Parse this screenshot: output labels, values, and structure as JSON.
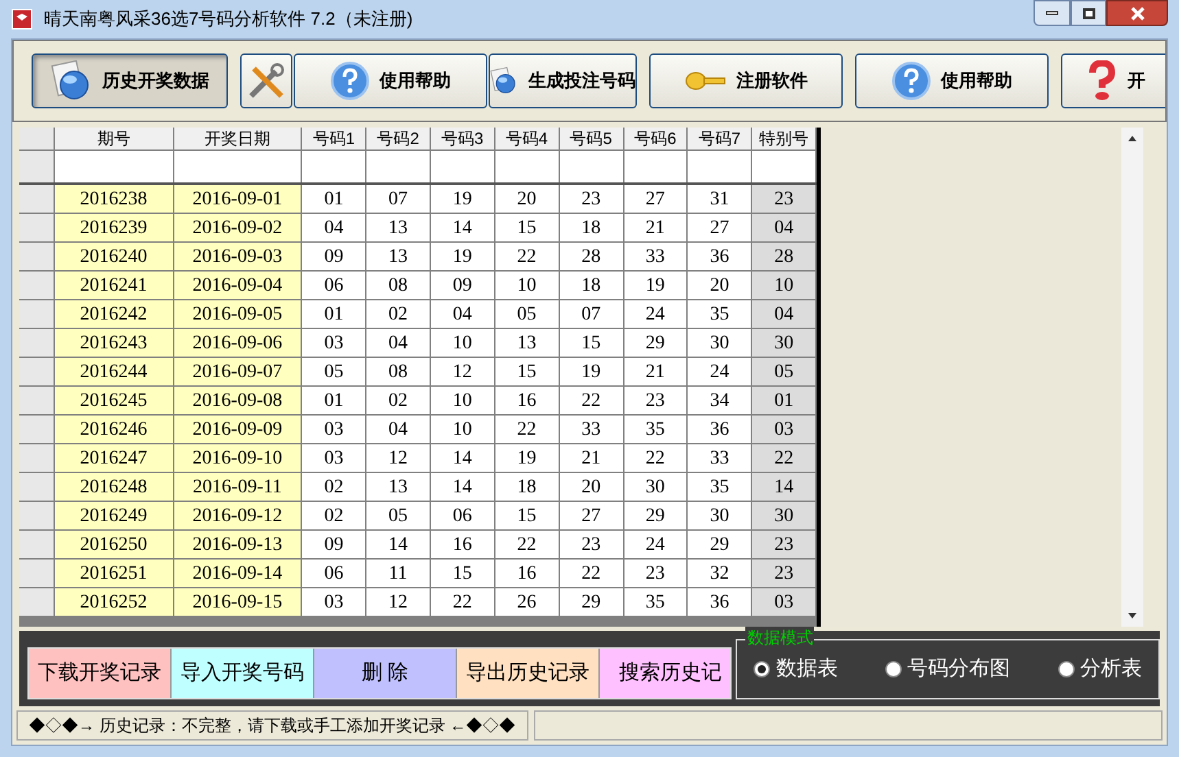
{
  "window": {
    "title": "晴天南粤风采36选7号码分析软件 7.2（未注册)"
  },
  "toolbar": {
    "buttons": [
      {
        "label": "历史开奖数据",
        "kind": "globe",
        "selected": true
      },
      {
        "kind": "tools",
        "selected": false
      },
      {
        "label": "使用帮助",
        "kind": "help",
        "selected": false
      },
      {
        "label": "生成投注号码",
        "kind": "globe",
        "selected": false
      },
      {
        "label": "注册软件",
        "kind": "key",
        "selected": false
      },
      {
        "label": "使用帮助",
        "kind": "help",
        "selected": false
      },
      {
        "label": "开",
        "kind": "question-red",
        "selected": false
      }
    ]
  },
  "table": {
    "columns": [
      "期号",
      "开奖日期",
      "号码1",
      "号码2",
      "号码3",
      "号码4",
      "号码5",
      "号码6",
      "号码7",
      "特别号"
    ],
    "rows": [
      [
        "2016238",
        "2016-09-01",
        "01",
        "07",
        "19",
        "20",
        "23",
        "27",
        "31",
        "23"
      ],
      [
        "2016239",
        "2016-09-02",
        "04",
        "13",
        "14",
        "15",
        "18",
        "21",
        "27",
        "04"
      ],
      [
        "2016240",
        "2016-09-03",
        "09",
        "13",
        "19",
        "22",
        "28",
        "33",
        "36",
        "28"
      ],
      [
        "2016241",
        "2016-09-04",
        "06",
        "08",
        "09",
        "10",
        "18",
        "19",
        "20",
        "10"
      ],
      [
        "2016242",
        "2016-09-05",
        "01",
        "02",
        "04",
        "05",
        "07",
        "24",
        "35",
        "04"
      ],
      [
        "2016243",
        "2016-09-06",
        "03",
        "04",
        "10",
        "13",
        "15",
        "29",
        "30",
        "30"
      ],
      [
        "2016244",
        "2016-09-07",
        "05",
        "08",
        "12",
        "15",
        "19",
        "21",
        "24",
        "05"
      ],
      [
        "2016245",
        "2016-09-08",
        "01",
        "02",
        "10",
        "16",
        "22",
        "23",
        "34",
        "01"
      ],
      [
        "2016246",
        "2016-09-09",
        "03",
        "04",
        "10",
        "22",
        "33",
        "35",
        "36",
        "03"
      ],
      [
        "2016247",
        "2016-09-10",
        "03",
        "12",
        "14",
        "19",
        "21",
        "22",
        "33",
        "22"
      ],
      [
        "2016248",
        "2016-09-11",
        "02",
        "13",
        "14",
        "18",
        "20",
        "30",
        "35",
        "14"
      ],
      [
        "2016249",
        "2016-09-12",
        "02",
        "05",
        "06",
        "15",
        "27",
        "29",
        "30",
        "30"
      ],
      [
        "2016250",
        "2016-09-13",
        "09",
        "14",
        "16",
        "22",
        "23",
        "24",
        "29",
        "23"
      ],
      [
        "2016251",
        "2016-09-14",
        "06",
        "11",
        "15",
        "16",
        "22",
        "23",
        "32",
        "23"
      ],
      [
        "2016252",
        "2016-09-15",
        "03",
        "12",
        "22",
        "26",
        "29",
        "35",
        "36",
        "03"
      ]
    ]
  },
  "action_buttons": [
    {
      "label": "下载开奖记录",
      "color": "#ffc0c0"
    },
    {
      "label": "导入开奖号码",
      "color": "#c0ffff"
    },
    {
      "label": "删 除",
      "color": "#c0c0ff"
    },
    {
      "label": "导出历史记录",
      "color": "#ffe0c0"
    },
    {
      "label": "搜索历史记",
      "color": "#ffc0ff"
    }
  ],
  "data_mode": {
    "title": "数据模式",
    "options": [
      {
        "label": "数据表",
        "selected": true
      },
      {
        "label": "号码分布图",
        "selected": false
      },
      {
        "label": "分析表",
        "selected": false
      }
    ]
  },
  "status_bar": {
    "text": "◆◇◆→ 历史记录：不完整，请下载或手工添加开奖记录 ←◆◇◆"
  }
}
